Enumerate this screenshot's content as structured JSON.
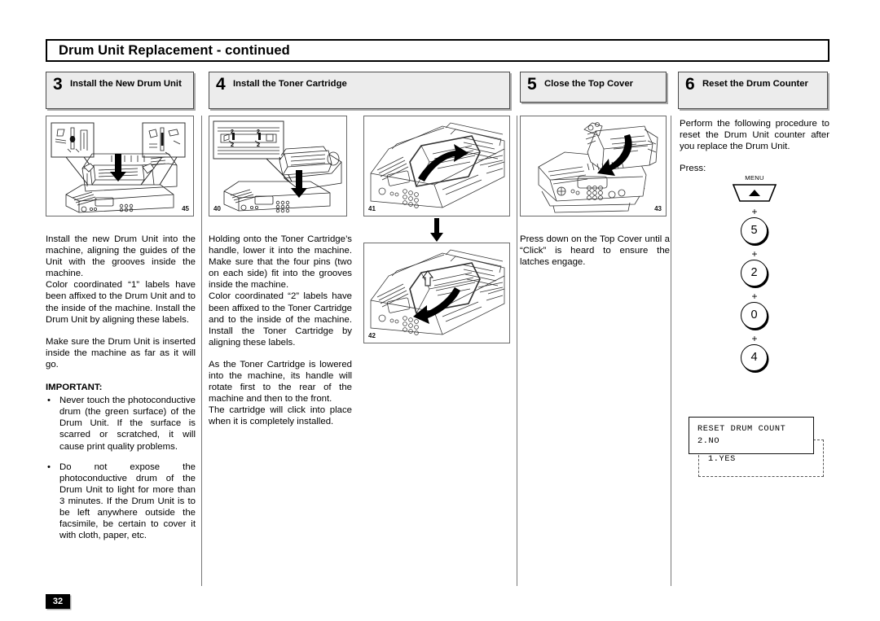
{
  "document": {
    "title": "Drum Unit Replacement - continued",
    "page_number": "32"
  },
  "steps": [
    {
      "number": "3",
      "label": "Install the New Drum Unit",
      "figure": "45"
    },
    {
      "number": "4",
      "label": "Install the Toner Cartridge",
      "figure": "40"
    },
    {
      "number": "5",
      "label": "Close the Top Cover",
      "figures": [
        "41",
        "42",
        "43"
      ]
    },
    {
      "number": "6",
      "label": "Reset the Drum Counter"
    }
  ],
  "figures": {
    "fig45": "45",
    "fig40": "40",
    "fig41": "41",
    "fig42": "42",
    "fig43": "43"
  },
  "column3": {
    "p1": "Install the new Drum Unit into the machine, aligning the guides of the Unit with the grooves inside the machine.",
    "p2": "Color coordinated “1” labels have been affixed to the Drum Unit and to the inside of the machine. Install the Drum Unit by aligning these labels.",
    "p3": "Make sure the Drum Unit is inserted inside the machine as far as it will go.",
    "important_header": "IMPORTANT:",
    "bullet_marker": "•",
    "bullets": [
      "Never touch the photoconductive drum (the green surface) of the Drum Unit. If the surface is scarred or scratched, it will cause print quality problems.",
      "Do not expose the photoconductive drum of the Drum Unit to light for more than 3 minutes. If the Drum Unit is to be left anywhere outside the facsimile, be certain to cover it with cloth, paper, etc."
    ]
  },
  "column4": {
    "p1": "Holding onto the Toner Cartridge’s handle, lower it into the machine. Make sure that the four pins (two on each side) fit into the grooves inside the machine.",
    "p2": "Color coordinated “2” labels have been affixed to the Toner Cartridge and to the inside of the machine. Install the Toner Cartridge by aligning these labels.",
    "p3": "As the Toner Cartridge is lowered into the machine, its handle will rotate first to the rear of the machine and then to the front.",
    "p4": "The cartridge will click into place when it is completely installed."
  },
  "column5": {
    "p1": "Press down on the Top Cover until a “Click” is heard to ensure the latches engage."
  },
  "column6": {
    "p1": "Perform the following procedure to reset the Drum Unit counter after you replace the Drum Unit.",
    "p2": "Press:",
    "keys": {
      "menu_label": "MENU",
      "plus": "+",
      "k1": "5",
      "k2": "2",
      "k3": "0",
      "k4": "4"
    },
    "lcd": {
      "line1": "RESET DRUM COUNT",
      "line2": "2.NO",
      "alt_line": "1.YES"
    }
  },
  "colors": {
    "header_fill": "#ececec",
    "header_border": "#4a4a4a",
    "ink": "#000000",
    "divider": "#777777"
  }
}
